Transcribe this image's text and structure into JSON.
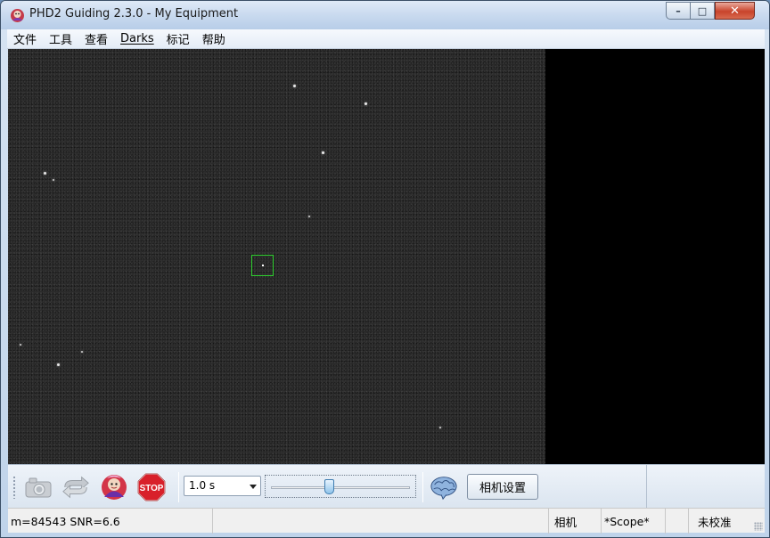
{
  "window": {
    "title": "PHD2 Guiding 2.3.0 - My Equipment",
    "controls": {
      "minimize": "–",
      "maximize": "□",
      "close": "✕"
    }
  },
  "menu": {
    "items": [
      {
        "label": "文件"
      },
      {
        "label": "工具"
      },
      {
        "label": "查看"
      },
      {
        "label": "Darks"
      },
      {
        "label": "标记"
      },
      {
        "label": "帮助"
      }
    ]
  },
  "toolbar": {
    "icons": [
      "camera-icon",
      "loop-icon",
      "guide-icon",
      "stop-icon"
    ],
    "stop_label": "STOP",
    "exposure": "1.0 s",
    "gamma_level_fraction": 0.42,
    "brain_icon": "brain-icon",
    "camera_settings_label": "相机设置"
  },
  "statusbar": {
    "star_info": "m=84543 SNR=6.6",
    "camera": "相机",
    "scope": "*Scope*",
    "calibration": "未校准"
  },
  "colors": {
    "guide_box": "#2ed12e",
    "stop_red": "#d8202a",
    "slider_thumb": "#8fc4ea"
  }
}
